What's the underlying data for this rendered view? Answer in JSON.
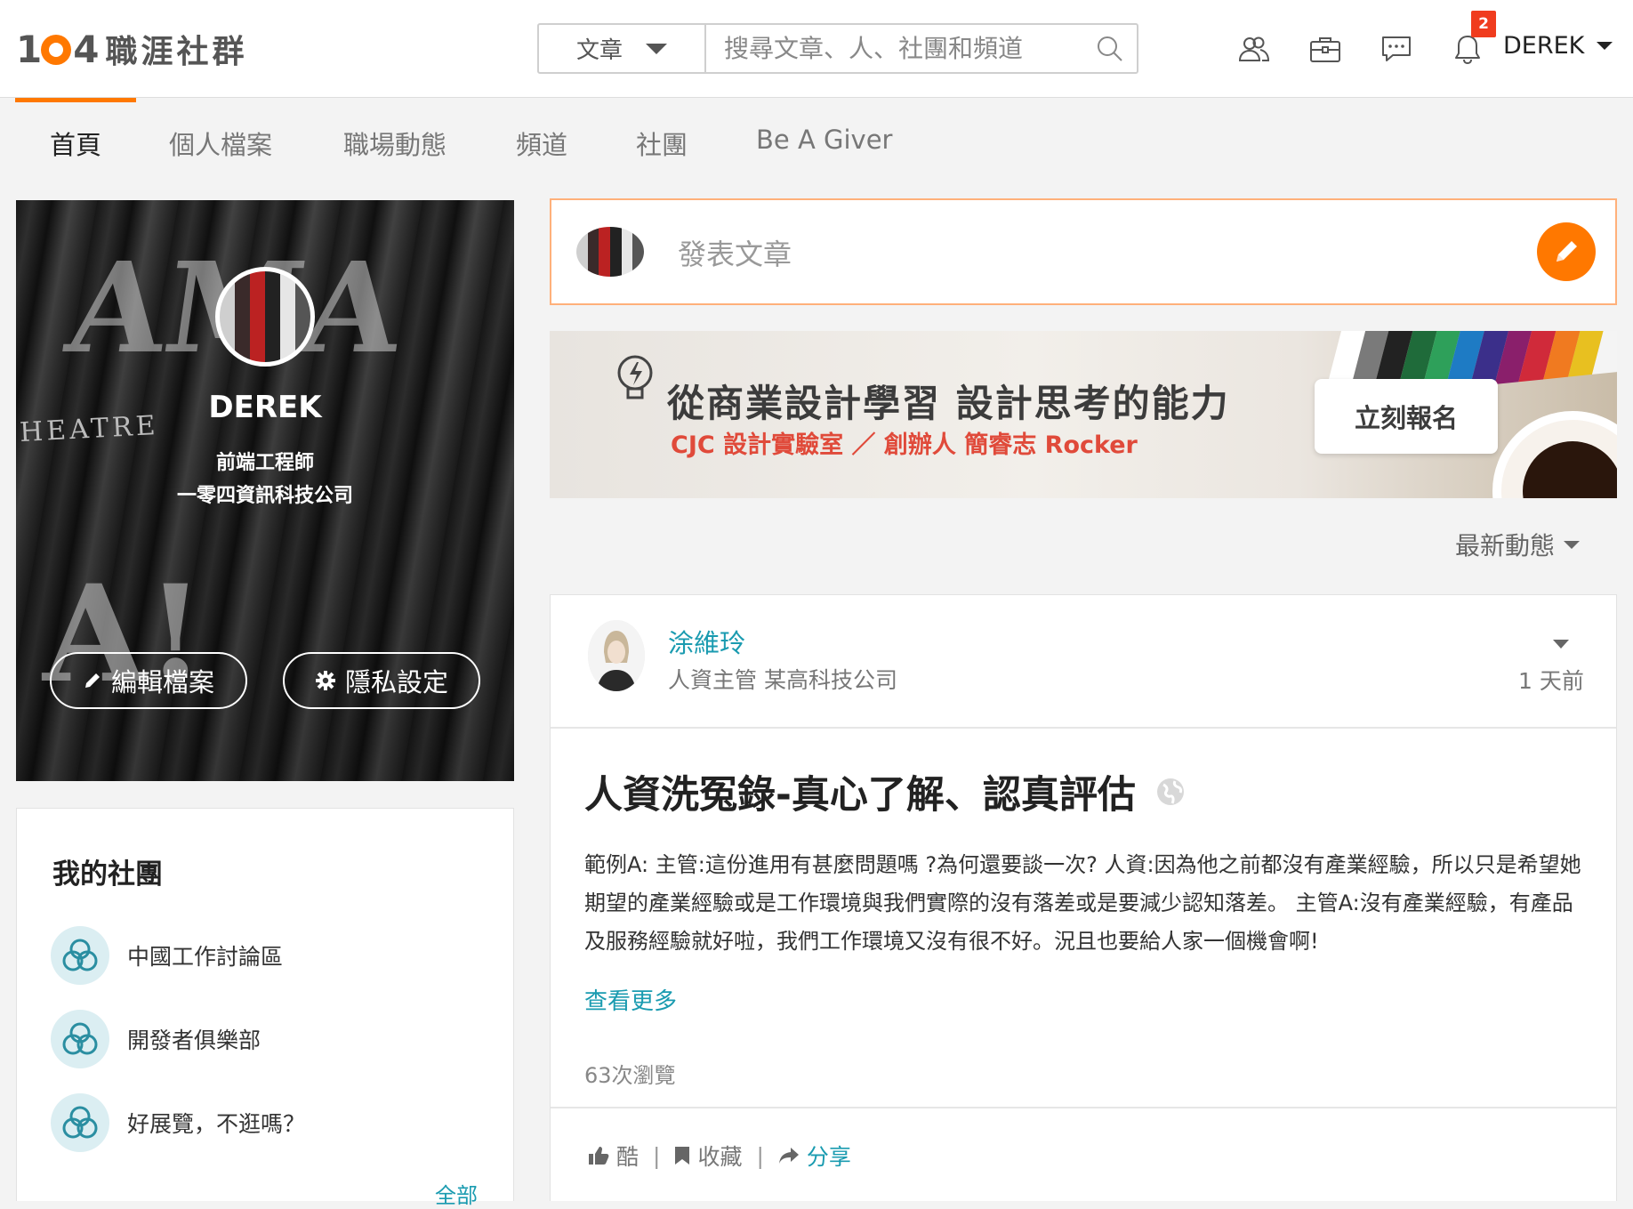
{
  "header": {
    "logo_number": "1",
    "logo_number_end": "4",
    "logo_text": "職涯社群",
    "search": {
      "type": "文章",
      "placeholder": "搜尋文章、人、社團和頻道"
    },
    "icons": [
      "people-icon",
      "briefcase-icon",
      "chat-icon",
      "bell-icon"
    ],
    "notification_count": "2",
    "user_name": "DEREK"
  },
  "tabs": [
    {
      "label": "首頁",
      "active": true
    },
    {
      "label": "個人檔案"
    },
    {
      "label": "職場動態"
    },
    {
      "label": "頻道"
    },
    {
      "label": "社團"
    },
    {
      "label": "Be A Giver"
    }
  ],
  "profile": {
    "name": "DEREK",
    "job_title": "前端工程師",
    "company": "一零四資訊科技公司",
    "edit_label": "編輯檔案",
    "privacy_label": "隱私設定"
  },
  "groups": {
    "title": "我的社團",
    "items": [
      "中國工作討論區",
      "開發者俱樂部",
      "好展覽，不逛嗎？"
    ],
    "more_label": "全部"
  },
  "compose": {
    "placeholder": "發表文章"
  },
  "banner": {
    "title": "從商業設計學習  設計思考的能力",
    "subtitle": "CJC 設計實驗室 ／ 創辦人 簡睿志 Rocker",
    "cta": "立刻報名"
  },
  "feed": {
    "sort_label": "最新動態"
  },
  "post": {
    "author": "涂維玲",
    "author_meta": "人資主管    某高科技公司",
    "time": "1 天前",
    "title": "人資洗冤錄-真心了解、認真評估",
    "body": "範例A: 主管:這份進用有甚麼問題嗎 ?為何還要談一次? 人資:因為他之前都沒有產業經驗，所以只是希望她期望的產業經驗或是工作環境與我們實際的沒有落差或是要減少認知落差。 主管A:沒有產業經驗，有產品及服務經驗就好啦，我們工作環境又沒有很不好。況且也要給人家一個機會啊!",
    "more_label": "查看更多",
    "views": "63次瀏覽",
    "actions": {
      "like": "酷",
      "save": "收藏",
      "share": "分享"
    }
  },
  "colors": {
    "accent": "#ff7800",
    "link": "#1a9bb0",
    "badge": "#f03c1e"
  }
}
